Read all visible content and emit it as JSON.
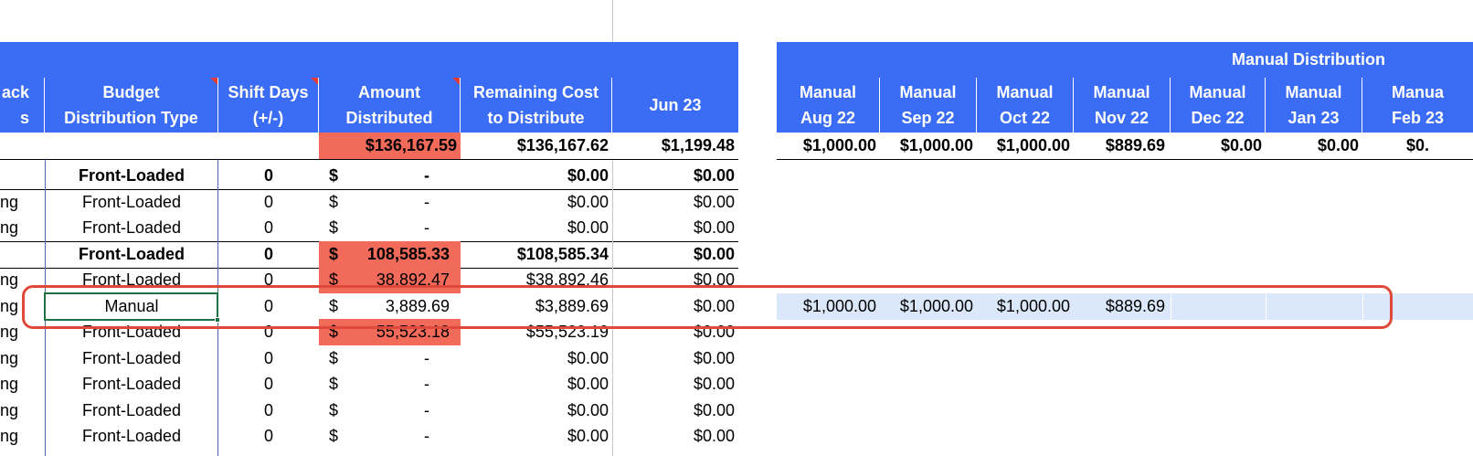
{
  "left_header": {
    "col_partial_1": "ack",
    "col_partial_2": "s",
    "budget_distribution_1": "Budget",
    "budget_distribution_2": "Distribution Type",
    "shift_days_1": "Shift Days",
    "shift_days_2": "(+/-)",
    "amount_1": "Amount",
    "amount_2": "Distributed",
    "remaining_1": "Remaining Cost",
    "remaining_2": "to Distribute",
    "jun23": "Jun 23"
  },
  "right_header": {
    "title": "Manual Distribution",
    "columns": [
      {
        "l1": "Manual",
        "l2": "Aug 22"
      },
      {
        "l1": "Manual",
        "l2": "Sep 22"
      },
      {
        "l1": "Manual",
        "l2": "Oct 22"
      },
      {
        "l1": "Manual",
        "l2": "Nov 22"
      },
      {
        "l1": "Manual",
        "l2": "Dec 22"
      },
      {
        "l1": "Manual",
        "l2": "Jan 23"
      },
      {
        "l1": "Manua",
        "l2": "Feb 23"
      }
    ]
  },
  "totals": {
    "amount": "$136,167.59",
    "remaining": "$136,167.62",
    "jun23": "$1,199.48",
    "manual": [
      "$1,000.00",
      "$1,000.00",
      "$1,000.00",
      "$889.69",
      "$0.00",
      "$0.00",
      "$0."
    ]
  },
  "rows": [
    {
      "lab": "",
      "type": "Front-Loaded",
      "shift": "0",
      "sym": "$",
      "amt": "-",
      "rem": "$0.00",
      "jun": "$0.00"
    },
    {
      "lab": "ng",
      "type": "Front-Loaded",
      "shift": "0",
      "sym": "$",
      "amt": "-",
      "rem": "$0.00",
      "jun": "$0.00"
    },
    {
      "lab": "ng",
      "type": "Front-Loaded",
      "shift": "0",
      "sym": "$",
      "amt": "-",
      "rem": "$0.00",
      "jun": "$0.00"
    },
    {
      "lab": "",
      "type": "Front-Loaded",
      "shift": "0",
      "sym": "$",
      "amt": "108,585.33",
      "rem": "$108,585.34",
      "jun": "$0.00"
    },
    {
      "lab": "ng",
      "type": "Front-Loaded",
      "shift": "0",
      "sym": "$",
      "amt": "38,892.47",
      "rem": "$38,892.46",
      "jun": "$0.00"
    },
    {
      "lab": "ng",
      "type": "Manual",
      "shift": "0",
      "sym": "$",
      "amt": "3,889.69",
      "rem": "$3,889.69",
      "jun": "$0.00",
      "manual": [
        "$1,000.00",
        "$1,000.00",
        "$1,000.00",
        "$889.69"
      ]
    },
    {
      "lab": "ng",
      "type": "Front-Loaded",
      "shift": "0",
      "sym": "$",
      "amt": "55,523.18",
      "rem": "$55,523.19",
      "jun": "$0.00"
    },
    {
      "lab": "ng",
      "type": "Front-Loaded",
      "shift": "0",
      "sym": "$",
      "amt": "-",
      "rem": "$0.00",
      "jun": "$0.00"
    },
    {
      "lab": "ng",
      "type": "Front-Loaded",
      "shift": "0",
      "sym": "$",
      "amt": "-",
      "rem": "$0.00",
      "jun": "$0.00"
    },
    {
      "lab": "ng",
      "type": "Front-Loaded",
      "shift": "0",
      "sym": "$",
      "amt": "-",
      "rem": "$0.00",
      "jun": "$0.00"
    },
    {
      "lab": "ng",
      "type": "Front-Loaded",
      "shift": "0",
      "sym": "$",
      "amt": "-",
      "rem": "$0.00",
      "jun": "$0.00"
    }
  ],
  "colors": {
    "header": "#3a6cf5",
    "red_fill": "#f26a5a",
    "highlight_row": "#dbe8fb",
    "annotation": "#e0483a",
    "selection": "#1e7145"
  }
}
